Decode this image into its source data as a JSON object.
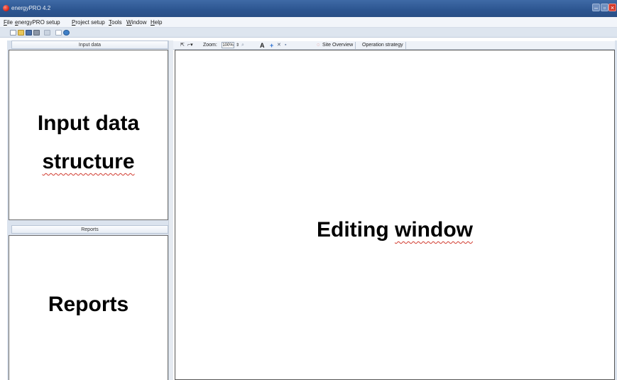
{
  "window": {
    "title": "energyPRO 4.2"
  },
  "menu": [
    {
      "label": "File",
      "accel": "F",
      "rest": "ile"
    },
    {
      "label": "energyPRO setup",
      "accel": "e",
      "rest": "nergyPRO setup"
    },
    {
      "label": "Project setup",
      "accel": "P",
      "rest": "roject setup"
    },
    {
      "label": "Tools",
      "accel": "T",
      "rest": "ools"
    },
    {
      "label": "Window",
      "accel": "W",
      "rest": "indow"
    },
    {
      "label": "Help",
      "accel": "H",
      "rest": "elp"
    }
  ],
  "left_panel": {
    "input_header": "Input data",
    "input_label_line1": "Input data",
    "input_label_line2": "structure",
    "reports_header": "Reports",
    "reports_label": "Reports"
  },
  "editor_toolbar": {
    "zoom_label": "Zoom:",
    "zoom_value": "100%",
    "text_tool": "A",
    "add_symbol": "+",
    "delete_symbol": "✕",
    "tabs": [
      "Site Overview",
      "Operation strategy"
    ]
  },
  "editing_window": {
    "label_word1": "Editing",
    "label_word2": "window"
  },
  "colors": {
    "titlebar": "#2c5590",
    "panel_bg": "#dbe3ee",
    "spellcheck": "#d23a2e",
    "app_icon": "#d81e10"
  },
  "icons": [
    "app-icon",
    "new-file-icon",
    "open-folder-icon",
    "save-icon",
    "print-icon",
    "cut-icon",
    "copy-icon",
    "refresh-icon",
    "pointer-icon",
    "connector-icon",
    "zoom-spin-icon",
    "zoom-glass-icon",
    "add-icon",
    "delete-icon",
    "save-small-icon",
    "site-overview-icon"
  ]
}
